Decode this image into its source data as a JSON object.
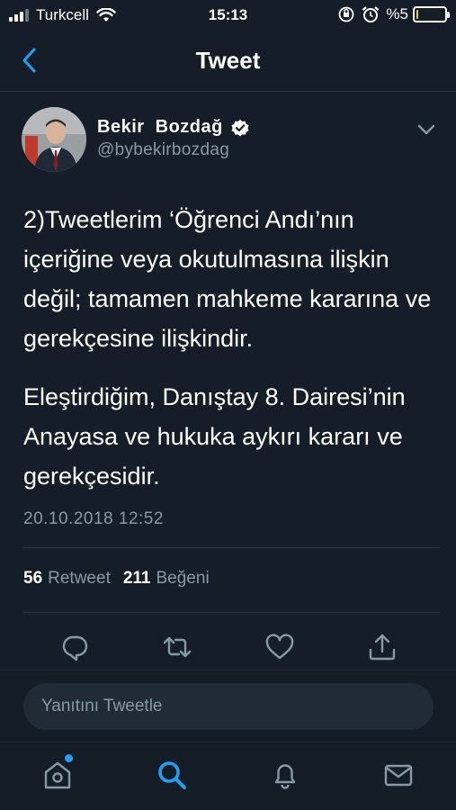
{
  "status_bar": {
    "carrier": "Turkcell",
    "time": "15:13",
    "battery_text": "%5",
    "battery_level": 0.05,
    "signal_bars": [
      true,
      true,
      true,
      false
    ]
  },
  "nav": {
    "title": "Tweet",
    "back_icon": "chevron-left-icon"
  },
  "tweet": {
    "author_name": "Bekir  Bozdağ",
    "author_handle": "@bybekirbozdag",
    "paragraph_1": "2)Tweetlerim ‘Öğrenci Andı’nın içeriğine veya okutulmasına ilişkin değil; tamamen mahkeme kararına ve gerekçesine ilişkindir.",
    "paragraph_2": "Eleştirdiğim, Danıştay 8. Dairesi’nin Anayasa ve hukuka aykırı kararı ve gerekçesidir.",
    "timestamp": "20.10.2018 12:52",
    "retweet_count": "56",
    "retweet_label": "Retweet",
    "like_count": "211",
    "like_label": "Beğeni"
  },
  "actions": [
    "reply-icon",
    "retweet-icon",
    "like-icon",
    "share-icon"
  ],
  "reply": {
    "placeholder": "Yanıtını Tweetle"
  },
  "tabs": [
    "home-icon",
    "search-icon",
    "notifications-icon",
    "messages-icon"
  ],
  "colors": {
    "background": "#151e28",
    "accent": "#1da1f2",
    "secondary_text": "#8899a6",
    "verified": "#ffffff",
    "battery": "#f5d21f"
  }
}
